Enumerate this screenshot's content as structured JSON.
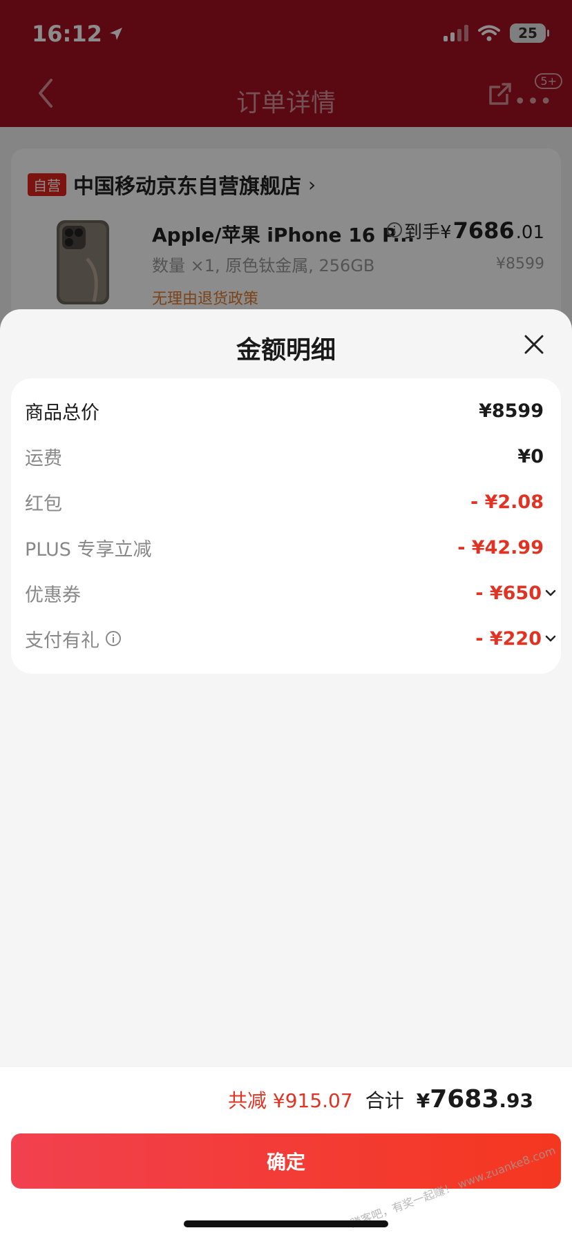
{
  "status_bar": {
    "time": "16:12",
    "battery": "25"
  },
  "nav": {
    "title": "订单详情",
    "badge": "5+",
    "more": "•••"
  },
  "store": {
    "tag": "自营",
    "name": "中国移动京东自营旗舰店",
    "chevron": "›",
    "product": {
      "title": "Apple/苹果 iPhone 16 P...",
      "price_prefix": "到手¥",
      "price_int": "7686",
      "price_dec": ".01",
      "spec": "数量 ×1, 原色钛金属, 256GB",
      "original_price": "¥8599",
      "policy": "无理由退货政策"
    }
  },
  "sheet": {
    "title": "金额明细",
    "rows": [
      {
        "label": "商品总价",
        "value": "¥8599"
      },
      {
        "label": "运费",
        "value": "¥0"
      },
      {
        "label": "红包",
        "value": "- ¥2.08"
      },
      {
        "label": "PLUS 专享立减",
        "value": "- ¥42.99"
      },
      {
        "label": "优惠券",
        "value": "- ¥650"
      },
      {
        "label": "支付有礼",
        "value": "- ¥220"
      }
    ]
  },
  "bottom": {
    "saved": "共减 ¥915.07",
    "total_label": "合计",
    "total_prefix": "¥",
    "total_int": "7683",
    "total_dec": ".93",
    "confirm_label": "确定",
    "watermark": "赚客吧，有奖一起赚！ www.zuanke8.com"
  },
  "colors": {
    "accent_red": "#e03323",
    "nav_red": "#a40f1f",
    "button_red": "#f23a32"
  }
}
